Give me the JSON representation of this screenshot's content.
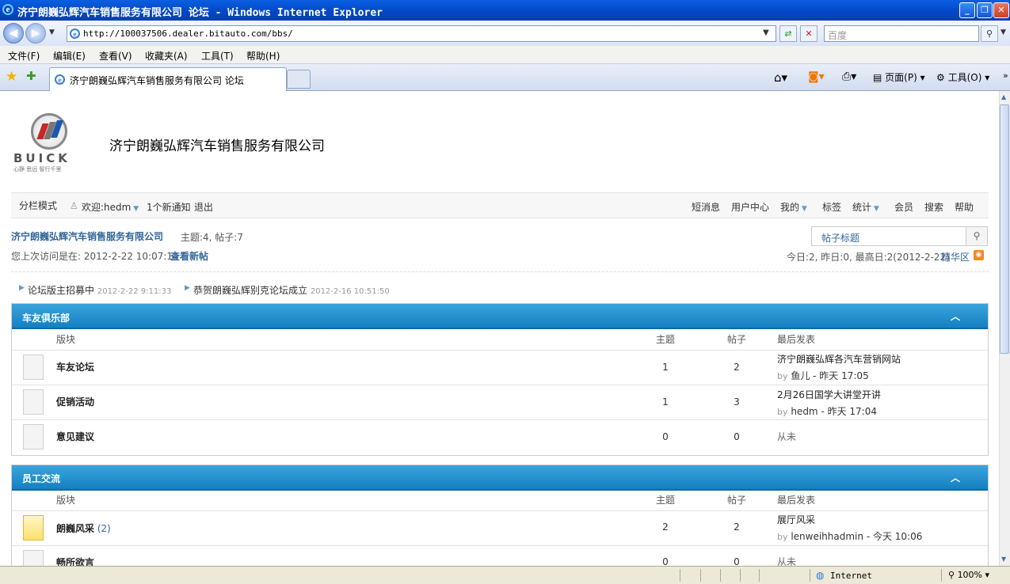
{
  "window": {
    "title": "济宁朗巍弘辉汽车销售服务有限公司 论坛 - Windows Internet Explorer"
  },
  "address": {
    "url": "http://100037506.dealer.bitauto.com/bbs/",
    "search_placeholder": "百度"
  },
  "menu": [
    "文件(F)",
    "编辑(E)",
    "查看(V)",
    "收藏夹(A)",
    "工具(T)",
    "帮助(H)"
  ],
  "tab": {
    "label": "济宁朗巍弘辉汽车销售服务有限公司 论坛"
  },
  "toolbar": {
    "page": "页面(P)",
    "tools": "工具(O)"
  },
  "site": {
    "brand": "BUICK",
    "slogan": "心静 思远 智行千里",
    "name": "济宁朗巍弘辉汽车销售服务有限公司"
  },
  "userbar": {
    "mode": "分栏模式",
    "welcome": "欢迎:hedm",
    "notify": "1个新通知",
    "logout": "退出",
    "right": [
      "短消息",
      "用户中心",
      "我的",
      "标签",
      "统计",
      "会员",
      "搜索",
      "帮助"
    ]
  },
  "info": {
    "forum_link": "济宁朗巍弘辉汽车销售服务有限公司",
    "stats": "主题:4, 帖子:7",
    "last_visit": "您上次访问是在: 2012-2-22 10:07:14",
    "new_posts": "查看新帖",
    "search_placeholder": "帖子标题",
    "today": "今日:2, 昨日:0, 最高日:2(2012-2-22)",
    "digest": "精华区"
  },
  "announcements": [
    {
      "title": "论坛版主招募中",
      "time": "2012-2-22 9:11:33"
    },
    {
      "title": "恭贺朗巍弘辉别克论坛成立",
      "time": "2012-2-16 10:51:50"
    }
  ],
  "headers": {
    "forum": "版块",
    "topics": "主题",
    "posts": "帖子",
    "last": "最后发表"
  },
  "sections": [
    {
      "title": "车友俱乐部",
      "forums": [
        {
          "name": "车友论坛",
          "extra": "",
          "topics": "1",
          "posts": "2",
          "last_title": "济宁朗巍弘辉各汽车营销网站",
          "by": "by",
          "author": "鱼儿",
          "time": " - 昨天 17:05"
        },
        {
          "name": "促销活动",
          "extra": "",
          "topics": "1",
          "posts": "3",
          "last_title": "2月26日国学大讲堂开讲",
          "by": "by",
          "author": "hedm",
          "time": " - 昨天 17:04"
        },
        {
          "name": "意见建议",
          "extra": "",
          "topics": "0",
          "posts": "0",
          "last_title": "从未",
          "by": "",
          "author": "",
          "time": ""
        }
      ]
    },
    {
      "title": "员工交流",
      "forums": [
        {
          "name": "朗巍风采",
          "extra": "(2)",
          "topics": "2",
          "posts": "2",
          "last_title": "展厅风采",
          "by": "by",
          "author": "lenweihhadmin",
          "time": " - 今天 10:06"
        },
        {
          "name": "畅所欲言",
          "extra": "",
          "topics": "0",
          "posts": "0",
          "last_title": "从未",
          "by": "",
          "author": "",
          "time": ""
        }
      ]
    }
  ],
  "status": {
    "zone": "Internet",
    "zoom": "100%"
  }
}
